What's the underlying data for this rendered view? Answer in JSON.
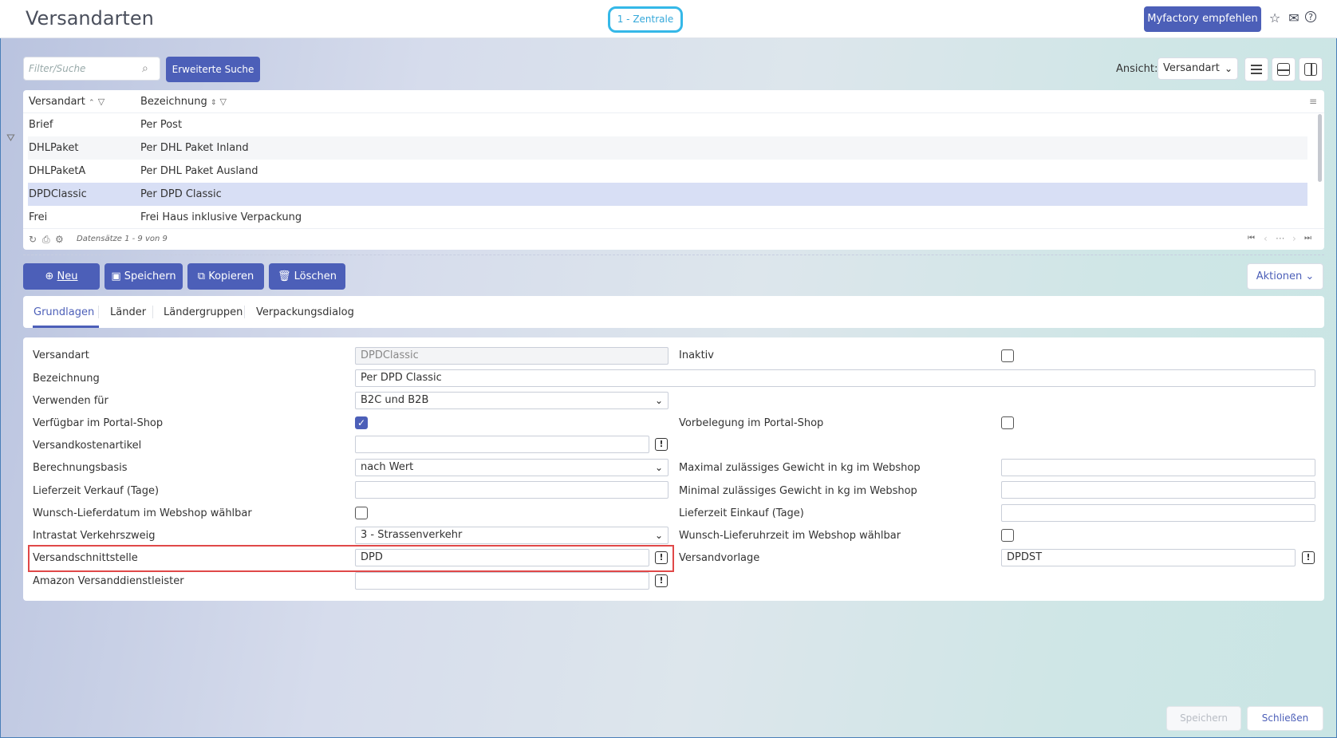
{
  "header": {
    "title": "Versandarten",
    "company": "1 - Zentrale",
    "recommend": "Myfactory empfehlen",
    "icons": [
      "star-icon",
      "mail-icon",
      "help-icon"
    ]
  },
  "search": {
    "placeholder": "Filter/Suche",
    "extended": "Erweiterte Suche",
    "view_label": "Ansicht:",
    "view_value": "Versandart"
  },
  "grid": {
    "columns": [
      "Versandart",
      "Bezeichnung"
    ],
    "rows": [
      [
        "Brief",
        "Per Post"
      ],
      [
        "DHLPaket",
        "Per DHL Paket Inland"
      ],
      [
        "DHLPaketA",
        "Per DHL Paket Ausland"
      ],
      [
        "DPDClassic",
        "Per DPD Classic"
      ],
      [
        "Frei",
        "Frei Haus inklusive Verpackung"
      ]
    ],
    "selected_row": 3,
    "records": "Datensätze 1 - 9 von 9"
  },
  "actions": {
    "new": "Neu",
    "save": "Speichern",
    "copy": "Kopieren",
    "delete": "Löschen",
    "more": "Aktionen"
  },
  "tabs": [
    "Grundlagen",
    "Länder",
    "Ländergruppen",
    "Verpackungsdialog"
  ],
  "form": {
    "versandart_label": "Versandart",
    "versandart_value": "DPDClassic",
    "inaktiv_label": "Inaktiv",
    "bezeichnung_label": "Bezeichnung",
    "bezeichnung_value": "Per DPD Classic",
    "verwenden_label": "Verwenden für",
    "verwenden_value": "B2C und B2B",
    "portal_label": "Verfügbar im Portal-Shop",
    "portal_checked": true,
    "vorbelegung_label": "Vorbelegung im Portal-Shop",
    "artikel_label": "Versandkostenartikel",
    "artikel_value": "",
    "basis_label": "Berechnungsbasis",
    "basis_value": "nach Wert",
    "max_label": "Maximal zulässiges Gewicht in kg im Webshop",
    "lieferzeit_label": "Lieferzeit Verkauf (Tage)",
    "min_label": "Minimal zulässiges Gewicht in kg im Webshop",
    "wunschdatum_label": "Wunsch-Lieferdatum im Webshop wählbar",
    "einkauf_label": "Lieferzeit Einkauf (Tage)",
    "intrastat_label": "Intrastat Verkehrszweig",
    "intrastat_value": "3 - Strassenverkehr",
    "wunschuhr_label": "Wunsch-Lieferuhrzeit im Webshop wählbar",
    "schnittstelle_label": "Versandschnittstelle",
    "schnittstelle_value": "DPD",
    "vorlage_label": "Versandvorlage",
    "vorlage_value": "DPDST",
    "amazon_label": "Amazon Versanddienstleister",
    "amazon_value": ""
  },
  "footer": {
    "save": "Speichern",
    "close": "Schließen"
  },
  "colors": {
    "accent": "#4c5fb8",
    "badge": "#35b8e8",
    "highlight": "#e04848",
    "selected_row": "#d8dff5"
  }
}
